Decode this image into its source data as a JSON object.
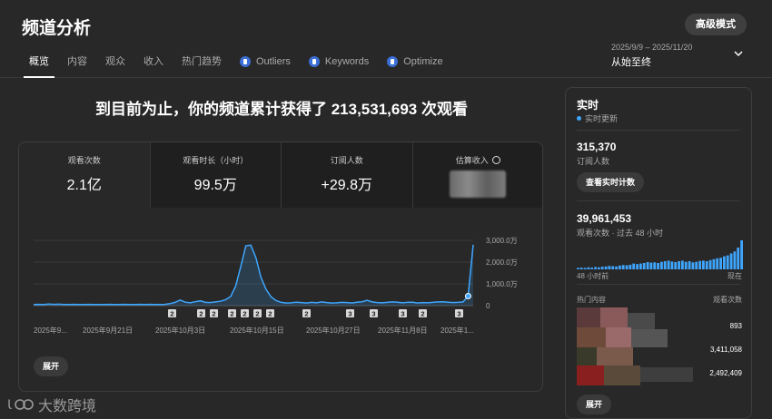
{
  "header": {
    "title": "频道分析",
    "advanced_mode": "高级模式",
    "tabs": [
      {
        "label": "概览",
        "plugin": false
      },
      {
        "label": "内容",
        "plugin": false
      },
      {
        "label": "观众",
        "plugin": false
      },
      {
        "label": "收入",
        "plugin": false
      },
      {
        "label": "热门趋势",
        "plugin": false
      },
      {
        "label": "Outliers",
        "plugin": true
      },
      {
        "label": "Keywords",
        "plugin": true
      },
      {
        "label": "Optimize",
        "plugin": true
      }
    ],
    "date_range": "2025/9/9 – 2025/11/20",
    "date_label": "从始至终"
  },
  "headline": "到目前为止，你的频道累计获得了 213,531,693 次观看",
  "metrics": [
    {
      "label": "观看次数",
      "value": "2.1亿"
    },
    {
      "label": "观看时长（小时）",
      "value": "99.5万"
    },
    {
      "label": "订阅人数",
      "value": "+29.8万"
    },
    {
      "label": "估算收入",
      "value": ""
    }
  ],
  "expand_label": "展开",
  "chart_data": {
    "type": "line",
    "x_labels": [
      "2025年9...",
      "2025年9月21日",
      "2025年10月3日",
      "2025年10月15日",
      "2025年10月27日",
      "2025年11月8日",
      "2025年1..."
    ],
    "y_ticks": [
      "3,000.0万",
      "2,000.0万",
      "1,000.0万",
      "0"
    ],
    "ylim": [
      0,
      30000000
    ],
    "values": [
      500000,
      600000,
      550000,
      700000,
      600000,
      650000,
      500000,
      550000,
      600000,
      500000,
      550000,
      600000,
      500000,
      550000,
      500000,
      600000,
      550000,
      500000,
      600000,
      550000,
      500000,
      600000,
      550000,
      600000,
      500000,
      550000,
      600000,
      900000,
      1500000,
      2600000,
      1600000,
      1300000,
      1800000,
      2200000,
      1500000,
      1400000,
      1700000,
      2000000,
      2700000,
      4200000,
      9000000,
      18000000,
      27500000,
      27800000,
      22000000,
      13000000,
      7500000,
      4000000,
      2300000,
      1500000,
      1200000,
      1300000,
      1600000,
      1400000,
      1200000,
      1500000,
      1300000,
      1700000,
      1400000,
      1200000,
      1300000,
      1500000,
      1400000,
      1200000,
      1600000,
      1800000,
      2400000,
      1700000,
      1400000,
      1300000,
      1500000,
      1700000,
      1600000,
      1300000,
      1500000,
      1600000,
      1200000,
      1400000,
      1300000,
      1500000,
      1700000,
      1800000,
      1600000,
      1400000,
      1500000,
      1700000,
      4400000,
      28000000
    ],
    "markers": [
      "2",
      "2",
      "2",
      "2",
      "2",
      "2",
      "2",
      "2",
      "3",
      "3",
      "3",
      "2",
      "3"
    ],
    "grid": true
  },
  "realtime": {
    "title": "实时",
    "live_label": "实时更新",
    "subscribers_value": "315,370",
    "subscribers_label": "订阅人数",
    "live_count_button": "查看实时计数",
    "views_value": "39,961,453",
    "views_label": "观看次数 · 过去 48 小时",
    "axis_left": "48 小时前",
    "axis_right": "现在",
    "top_content_label": "热门内容",
    "top_views_label": "观看次数",
    "rows": [
      {
        "value": "893"
      },
      {
        "value": "3,411,058"
      },
      {
        "value": "2,492,409"
      }
    ],
    "expand_label": "展开",
    "bars": [
      0.05,
      0.06,
      0.05,
      0.07,
      0.06,
      0.08,
      0.07,
      0.09,
      0.1,
      0.12,
      0.11,
      0.1,
      0.13,
      0.15,
      0.14,
      0.16,
      0.2,
      0.18,
      0.2,
      0.22,
      0.25,
      0.23,
      0.24,
      0.22,
      0.26,
      0.28,
      0.3,
      0.27,
      0.25,
      0.28,
      0.3,
      0.26,
      0.28,
      0.24,
      0.26,
      0.29,
      0.3,
      0.28,
      0.32,
      0.35,
      0.38,
      0.4,
      0.45,
      0.48,
      0.55,
      0.62,
      0.75,
      1.0
    ]
  },
  "watermark": "大数跨境",
  "colors": {
    "accent": "#3ea6ff",
    "plugin": "#3b6fd6",
    "background": "#282828",
    "panel": "#1f1f1f"
  }
}
